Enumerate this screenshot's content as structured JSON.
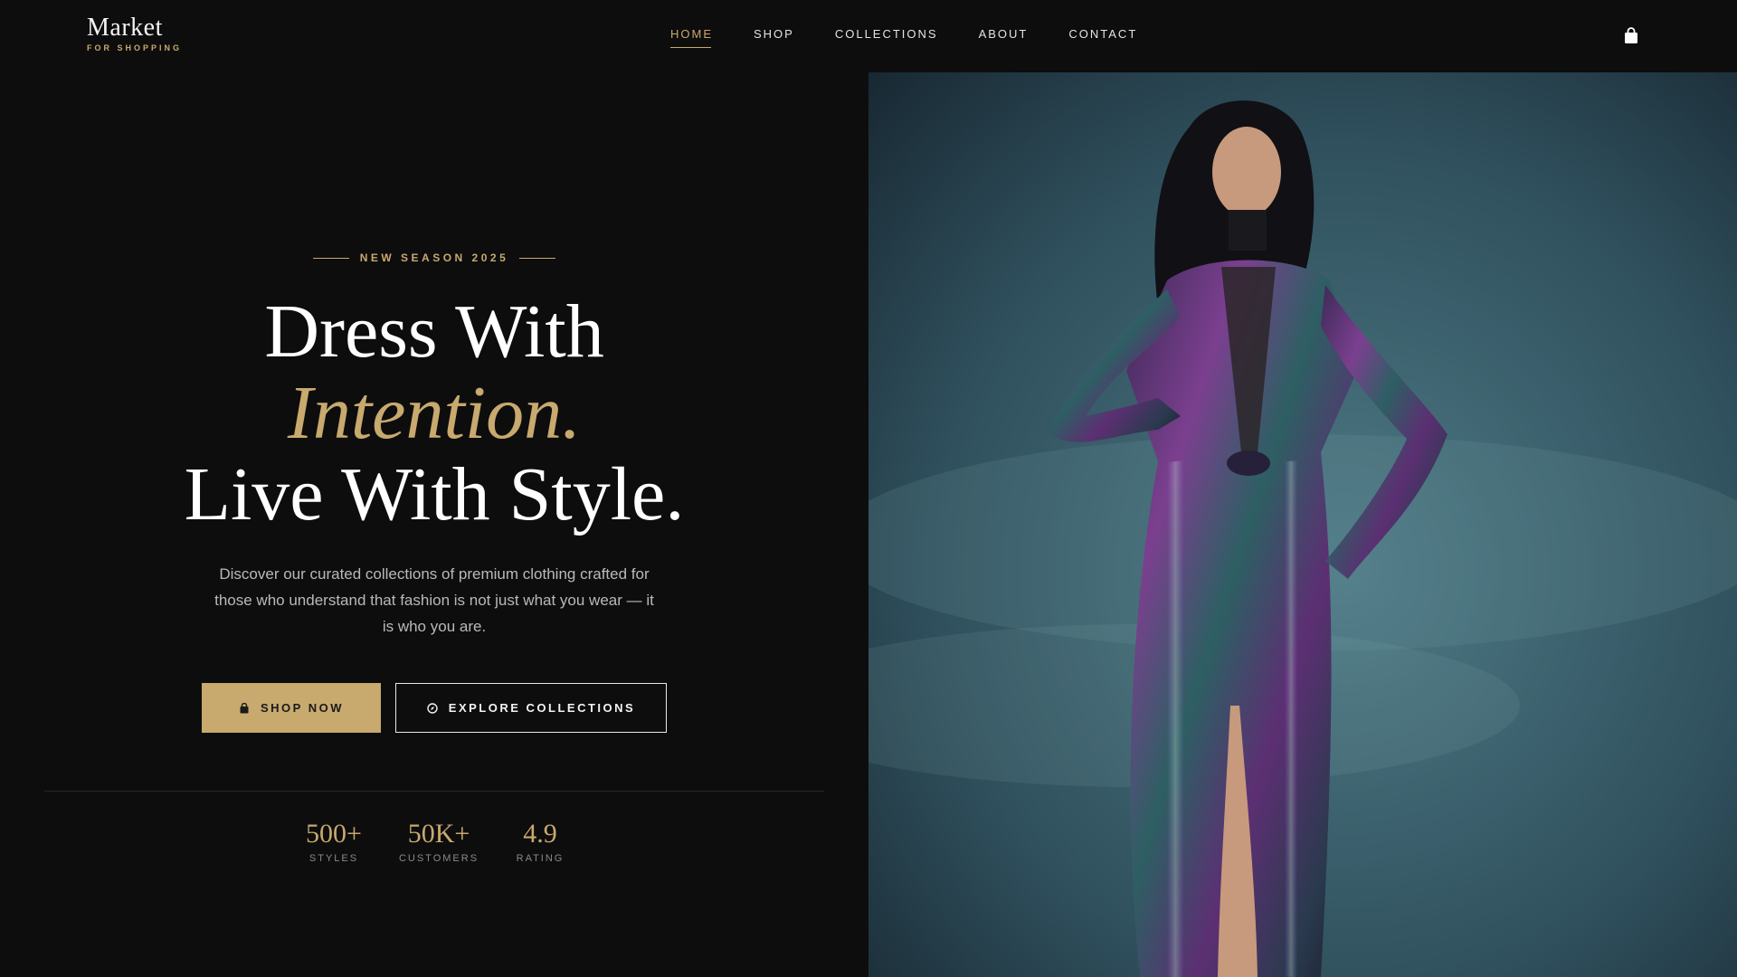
{
  "brand": {
    "name": "Market",
    "tagline": "FOR SHOPPING"
  },
  "nav": {
    "items": [
      {
        "label": "HOME",
        "active": true
      },
      {
        "label": "SHOP",
        "active": false
      },
      {
        "label": "COLLECTIONS",
        "active": false
      },
      {
        "label": "ABOUT",
        "active": false
      },
      {
        "label": "CONTACT",
        "active": false
      }
    ],
    "cart_icon": "shopping-bag-icon"
  },
  "hero": {
    "eyebrow": "NEW SEASON 2025",
    "headline": {
      "line1": "Dress With",
      "line2": "Intention.",
      "line3": "Live With Style."
    },
    "description": "Discover our curated collections of premium clothing crafted for those who understand that fashion is not just what you wear — it is who you are.",
    "primary_cta": {
      "label": "SHOP NOW",
      "icon": "shopping-bag-icon"
    },
    "secondary_cta": {
      "label": "EXPLORE COLLECTIONS",
      "icon": "compass-icon"
    }
  },
  "stats": [
    {
      "value": "500+",
      "label": "STYLES"
    },
    {
      "value": "50K+",
      "label": "CUSTOMERS"
    },
    {
      "value": "4.9",
      "label": "RATING"
    }
  ],
  "image": {
    "subject": "model-in-iridescent-gown"
  },
  "colors": {
    "accent": "#c8a96e",
    "background": "#0d0d0d",
    "text": "#ffffff",
    "muted": "#b9b9b9"
  }
}
